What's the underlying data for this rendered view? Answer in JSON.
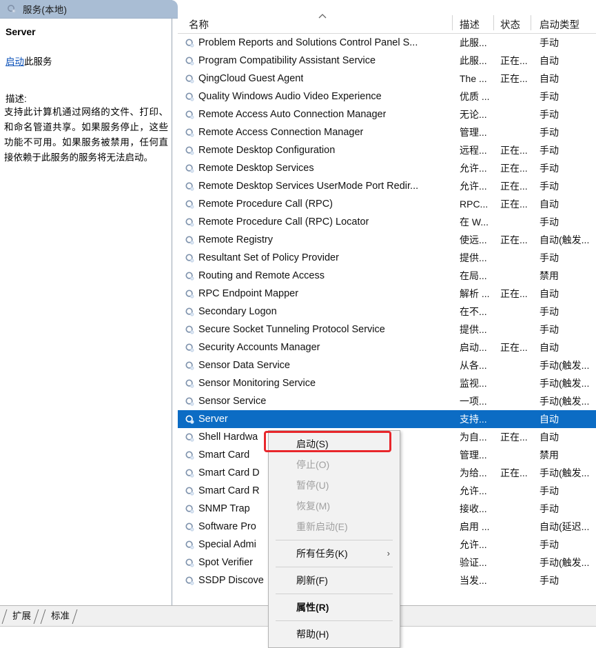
{
  "window": {
    "header_title": "服务(本地)",
    "header_icon": "services-gear-icon"
  },
  "left_panel": {
    "service_name": "Server",
    "action_link": "启动",
    "action_link_tail": "此服务",
    "description_label": "描述:",
    "description_text": "支持此计算机通过网络的文件、打印、和命名管道共享。如果服务停止，这些功能不可用。如果服务被禁用，任何直接依赖于此服务的服务将无法启动。"
  },
  "list": {
    "columns": {
      "name": "名称",
      "description": "描述",
      "status": "状态",
      "startup_type": "启动类型",
      "sort_indicator": "︿"
    },
    "rows": [
      {
        "name": "Problem Reports and Solutions Control Panel S...",
        "desc": "此服...",
        "state": "",
        "start": "手动"
      },
      {
        "name": "Program Compatibility Assistant Service",
        "desc": "此服...",
        "state": "正在...",
        "start": "自动"
      },
      {
        "name": "QingCloud Guest Agent",
        "desc": "The ...",
        "state": "正在...",
        "start": "自动"
      },
      {
        "name": "Quality Windows Audio Video Experience",
        "desc": "优质 ...",
        "state": "",
        "start": "手动"
      },
      {
        "name": "Remote Access Auto Connection Manager",
        "desc": "无论...",
        "state": "",
        "start": "手动"
      },
      {
        "name": "Remote Access Connection Manager",
        "desc": "管理...",
        "state": "",
        "start": "手动"
      },
      {
        "name": "Remote Desktop Configuration",
        "desc": "远程...",
        "state": "正在...",
        "start": "手动"
      },
      {
        "name": "Remote Desktop Services",
        "desc": "允许...",
        "state": "正在...",
        "start": "手动"
      },
      {
        "name": "Remote Desktop Services UserMode Port Redir...",
        "desc": "允许...",
        "state": "正在...",
        "start": "手动"
      },
      {
        "name": "Remote Procedure Call (RPC)",
        "desc": "RPC...",
        "state": "正在...",
        "start": "自动"
      },
      {
        "name": "Remote Procedure Call (RPC) Locator",
        "desc": "在 W...",
        "state": "",
        "start": "手动"
      },
      {
        "name": "Remote Registry",
        "desc": "使远...",
        "state": "正在...",
        "start": "自动(触发..."
      },
      {
        "name": "Resultant Set of Policy Provider",
        "desc": "提供...",
        "state": "",
        "start": "手动"
      },
      {
        "name": "Routing and Remote Access",
        "desc": "在局...",
        "state": "",
        "start": "禁用"
      },
      {
        "name": "RPC Endpoint Mapper",
        "desc": "解析 ...",
        "state": "正在...",
        "start": "自动"
      },
      {
        "name": "Secondary Logon",
        "desc": "在不...",
        "state": "",
        "start": "手动"
      },
      {
        "name": "Secure Socket Tunneling Protocol Service",
        "desc": "提供...",
        "state": "",
        "start": "手动"
      },
      {
        "name": "Security Accounts Manager",
        "desc": "启动...",
        "state": "正在...",
        "start": "自动"
      },
      {
        "name": "Sensor Data Service",
        "desc": "从各...",
        "state": "",
        "start": "手动(触发..."
      },
      {
        "name": "Sensor Monitoring Service",
        "desc": "监视...",
        "state": "",
        "start": "手动(触发..."
      },
      {
        "name": "Sensor Service",
        "desc": "一项...",
        "state": "",
        "start": "手动(触发..."
      },
      {
        "name": "Server",
        "desc": "支持...",
        "state": "",
        "start": "自动",
        "selected": true
      },
      {
        "name": "Shell Hardwa",
        "desc": "为自...",
        "state": "正在...",
        "start": "自动"
      },
      {
        "name": "Smart Card",
        "desc": "管理...",
        "state": "",
        "start": "禁用"
      },
      {
        "name": "Smart Card D",
        "desc": "为给...",
        "state": "正在...",
        "start": "手动(触发..."
      },
      {
        "name": "Smart Card R",
        "desc": "允许...",
        "state": "",
        "start": "手动"
      },
      {
        "name": "SNMP Trap",
        "desc": "接收...",
        "state": "",
        "start": "手动"
      },
      {
        "name": "Software Pro",
        "desc": "启用 ...",
        "state": "",
        "start": "自动(延迟..."
      },
      {
        "name": "Special Admi",
        "desc": "允许...",
        "state": "",
        "start": "手动"
      },
      {
        "name": "Spot Verifier",
        "desc": "验证...",
        "state": "",
        "start": "手动(触发..."
      },
      {
        "name": "SSDP Discove",
        "desc": "当发...",
        "state": "",
        "start": "手动"
      }
    ]
  },
  "context_menu": {
    "items": [
      {
        "label": "启动(S)",
        "disabled": false,
        "highlighted": true
      },
      {
        "label": "停止(O)",
        "disabled": true
      },
      {
        "label": "暂停(U)",
        "disabled": true
      },
      {
        "label": "恢复(M)",
        "disabled": true
      },
      {
        "label": "重新启动(E)",
        "disabled": true
      },
      {
        "separator": true
      },
      {
        "label": "所有任务(K)",
        "disabled": false,
        "submenu": true,
        "arrow": "›"
      },
      {
        "separator": true
      },
      {
        "label": "刷新(F)",
        "disabled": false
      },
      {
        "separator": true
      },
      {
        "label": "属性(R)",
        "disabled": false,
        "bold": true
      },
      {
        "separator": true
      },
      {
        "label": "帮助(H)",
        "disabled": false
      }
    ]
  },
  "tabs": [
    {
      "label": "扩展",
      "active": false
    },
    {
      "label": "标准",
      "active": true
    }
  ],
  "colors": {
    "header_bar": "#a9bdd4",
    "selection": "#0c6cc4",
    "link": "#0a50b8",
    "highlight_box": "#e8262b"
  }
}
